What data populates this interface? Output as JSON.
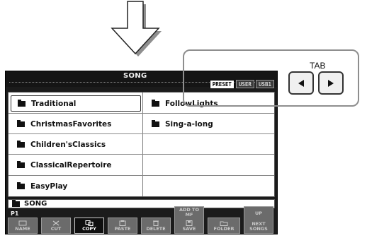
{
  "screen": {
    "title": "SONG",
    "tabs": [
      {
        "label": "PRESET",
        "active": true
      },
      {
        "label": "USER",
        "active": false
      },
      {
        "label": "USB1",
        "active": false
      }
    ],
    "folders_left": [
      "Traditional",
      "ChristmasFavorites",
      "Children'sClassics",
      "ClassicalRepertoire",
      "EasyPlay"
    ],
    "folders_right": [
      "FollowLights",
      "Sing-a-long"
    ],
    "selected_folder": "Traditional",
    "current_path": "SONG",
    "page": "P1",
    "buttons": [
      {
        "label": "NAME",
        "lit": false
      },
      {
        "label": "CUT",
        "lit": false
      },
      {
        "label": "COPY",
        "lit": true
      },
      {
        "label": "PASTE",
        "lit": false
      },
      {
        "label": "DELETE",
        "lit": false
      },
      {
        "label": "SAVE",
        "top_label": "ADD TO MF",
        "lit": false
      },
      {
        "label": "FOLDER",
        "lit": false
      },
      {
        "label": "NEXT SONGS",
        "top_label": "UP",
        "lit": false
      }
    ]
  },
  "panel_buttons": {
    "tab_label": "TAB",
    "left_icon": "triangle-left-icon",
    "right_icon": "triangle-right-icon"
  },
  "annotation": {
    "arrow_icon": "down-arrow-icon",
    "callout_color": "#8e8e8e"
  }
}
